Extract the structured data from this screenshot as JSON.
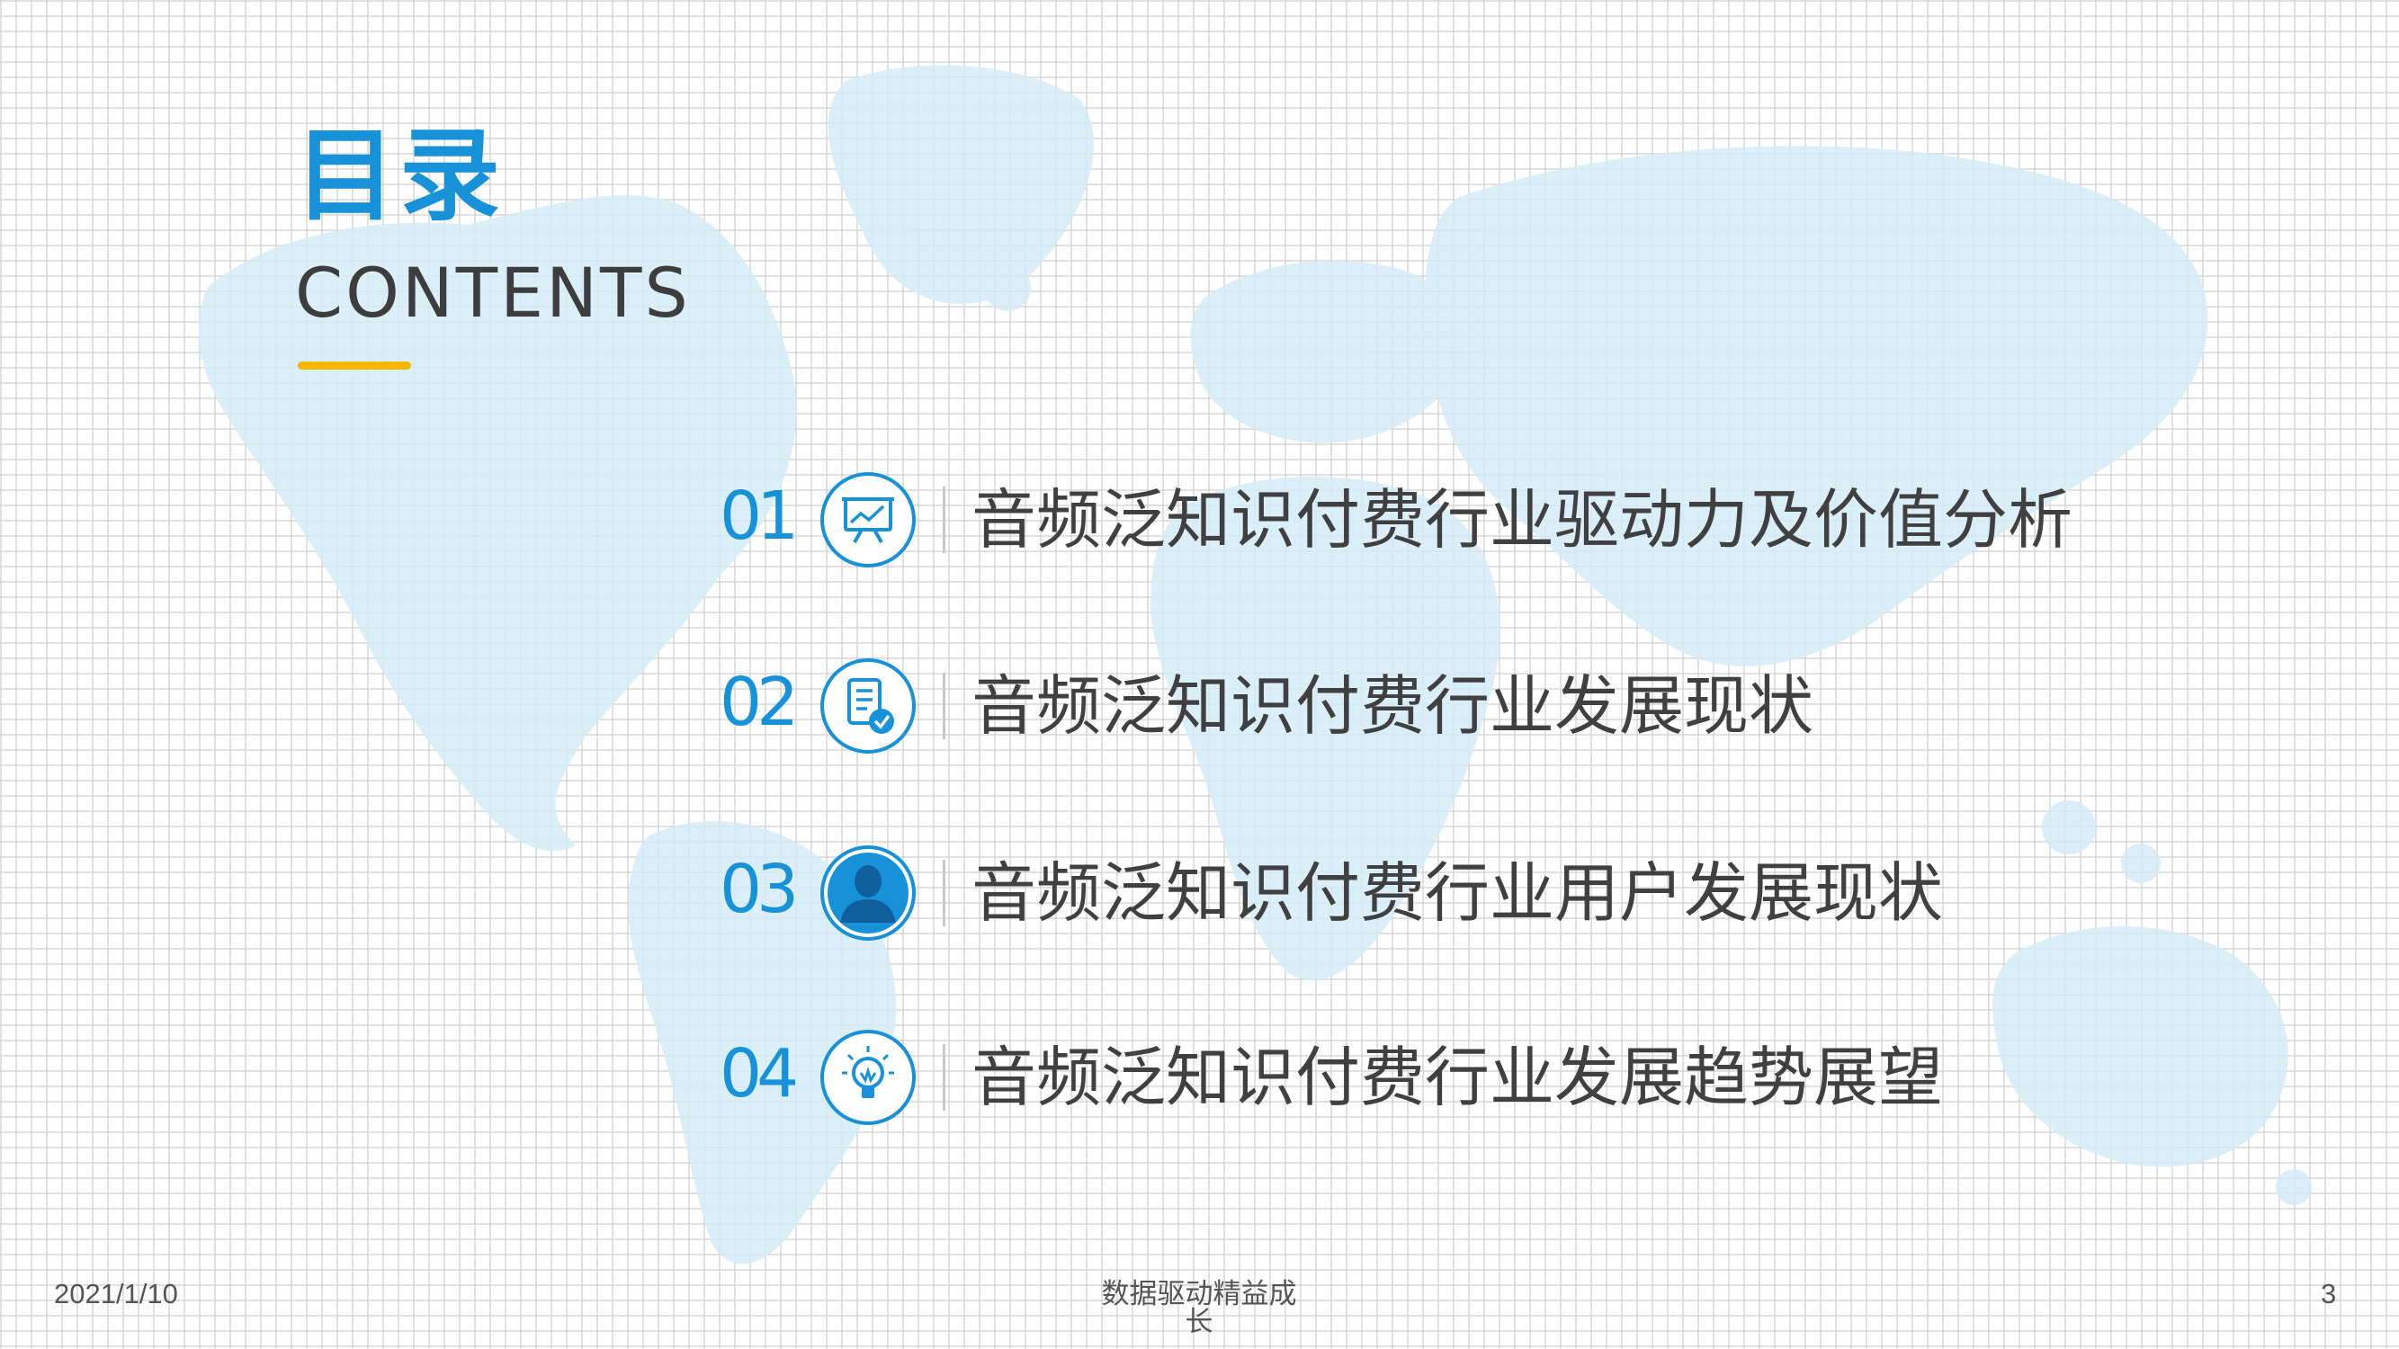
{
  "title": {
    "cn": "目录",
    "en": "CONTENTS"
  },
  "toc": [
    {
      "number": "01",
      "label": "音频泛知识付费行业驱动力及价值分析",
      "icon": "presentation-chart-icon"
    },
    {
      "number": "02",
      "label": "音频泛知识付费行业发展现状",
      "icon": "document-check-icon"
    },
    {
      "number": "03",
      "label": "音频泛知识付费行业用户发展现状",
      "icon": "user-icon"
    },
    {
      "number": "04",
      "label": "音频泛知识付费行业发展趋势展望",
      "icon": "lightbulb-icon"
    }
  ],
  "footer": {
    "date": "2021/1/10",
    "center": "数据驱动精益成长",
    "page": "3"
  },
  "colors": {
    "accent": "#1791d8",
    "underline": "#f5b800",
    "text": "#404040",
    "map": "#daeef8"
  }
}
